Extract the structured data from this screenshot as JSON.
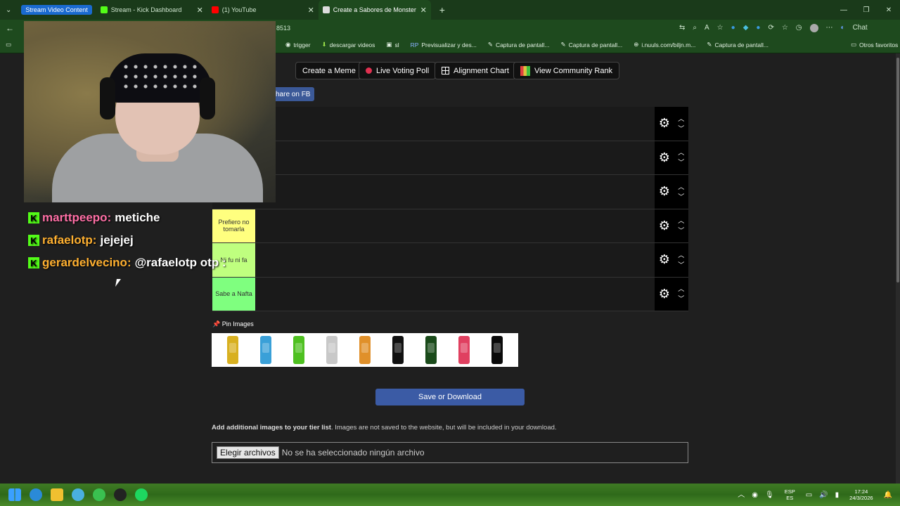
{
  "browser": {
    "tab_group": "Stream Video Content",
    "tabs": [
      {
        "label": "Stream - Kick Dashboard",
        "color": "#53fc18"
      },
      {
        "label": "(1) YouTube",
        "color": "#ff0000"
      },
      {
        "label": "Create a Sabores de Monster Ener",
        "color": "#1e4a1e"
      }
    ],
    "new_tab": "+",
    "address_fragment": "8513",
    "profile_label": "Chat",
    "bookmarks": [
      "trigger",
      "descargar videos",
      "sl",
      "Previsualizar y des...",
      "Captura de pantall...",
      "Captura de pantall...",
      "i.nuuls.com/biljn.m...",
      "Captura de pantall..."
    ],
    "other_bookmarks": "Otros favoritos"
  },
  "toolbar": {
    "create_meme": "Create a Meme",
    "live_voting": "Live Voting Poll",
    "alignment_chart": "Alignment Chart",
    "community_rank": "View Community Rank",
    "share_fb": "hare on FB"
  },
  "tiers": [
    {
      "label": "",
      "color": "#1a1a1a"
    },
    {
      "label": "",
      "color": "#1a1a1a"
    },
    {
      "label": "",
      "color": "#1a1a1a"
    },
    {
      "label": "Prefiero no tomarla",
      "color": "#ffff7f"
    },
    {
      "label": "Ni fu ni fa",
      "color": "#bfff7f"
    },
    {
      "label": "Sabe a Nafta",
      "color": "#7fff7f"
    }
  ],
  "pin_images_label": "Pin Images",
  "cans": [
    "#d8b020",
    "#3aa0d8",
    "#4ec020",
    "#c8c8c8",
    "#e0902a",
    "#111111",
    "#1a4a1a",
    "#e04060",
    "#0a0a0a"
  ],
  "save_button": "Save or Download",
  "add_images": {
    "bold": "Add additional images to your tier list",
    "rest": ". Images are not saved to the website, but will be included in your download."
  },
  "file_input": {
    "button": "Elegir archivos",
    "status": "No se ha seleccionado ningún archivo"
  },
  "chat": [
    {
      "user": "marttpeepo:",
      "color": "#ff6fa6",
      "message": "metiche"
    },
    {
      "user": "rafaelotp:",
      "color": "#ffb030",
      "message": "jejejej"
    },
    {
      "user": "gerardelvecino:",
      "color": "#ffb030",
      "message": "@rafaelotp otp :"
    }
  ],
  "kick_badge": "K",
  "tray": {
    "lang_line1": "ESP",
    "lang_line2": "ES",
    "time": "17:24",
    "date": "24/3/2026"
  }
}
